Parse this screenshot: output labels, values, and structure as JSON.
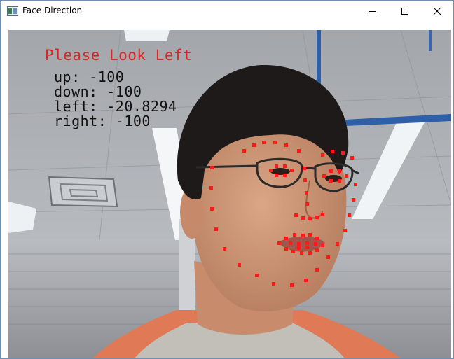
{
  "window": {
    "title": "Face Direction",
    "controls": {
      "minimize": "minimize",
      "maximize": "maximize",
      "close": "close"
    }
  },
  "overlay": {
    "prompt": "Please Look Left",
    "readings": [
      {
        "label": "up: -100"
      },
      {
        "label": "down: -100"
      },
      {
        "label": "left: -20.8294"
      },
      {
        "label": "right: -100"
      }
    ],
    "prompt_color": "#e02424",
    "reading_color": "#111111",
    "landmark_color": "#ff1a1a"
  },
  "icons": [
    "app-icon",
    "minimize-icon",
    "maximize-icon",
    "close-icon"
  ]
}
